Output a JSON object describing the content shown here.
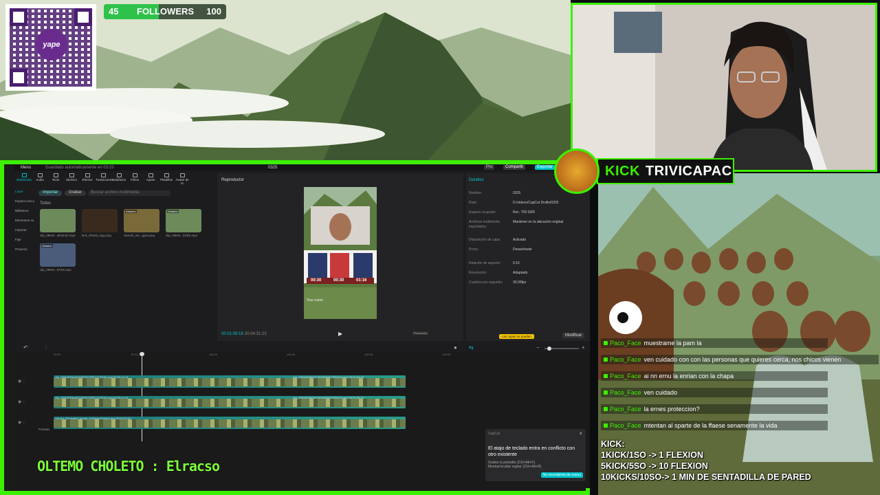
{
  "overlay": {
    "qr_brand": "yape",
    "followers": {
      "current": "45",
      "label": "FOLLOWERS",
      "goal": "100",
      "progress_fraction": 0.45
    },
    "kick_label": {
      "prefix": "KICK",
      "channel": "TRIVICAPAC"
    },
    "ticker_text": "OLTEMO CHOLETO : Elracso",
    "kick_rules": {
      "title": "KICK:",
      "lines": [
        "1KICK/1SO -> 1 FLEXION",
        "5KICK/5SO -> 10 FLEXION",
        "10KICKS/10SO-> 1 MIN DE SENTADILLA DE PARED"
      ]
    },
    "chat": [
      {
        "user": "Paco_Face",
        "message": "muestrame la pam la"
      },
      {
        "user": "Paco_Face",
        "message": "ven cuidado con con las personas que quieres cerca, nos chicos vienen"
      },
      {
        "user": "Paco_Face",
        "message": "ai nn ernu la enrian con la chapa"
      },
      {
        "user": "Paco_Face",
        "message": "ven cuidado"
      },
      {
        "user": "Paco_Face",
        "message": "la ernes proteccion?"
      },
      {
        "user": "Paco_Face",
        "message": "mtentan al sparte de la ffaese senamente la vida"
      }
    ],
    "colors": {
      "accent": "#3cf000",
      "followers_fill": "#2ec24a"
    }
  },
  "capcut": {
    "menu": "Menú",
    "autosave": "Guardado automáticamente en 03:23",
    "project_title": "0325",
    "top_right": {
      "pro": "Pro",
      "share": "Compartir",
      "export": "Exportar"
    },
    "toolbar": [
      "Multimedia",
      "Audio",
      "Texto",
      "Stickers",
      "Efectos",
      "Transiciones",
      "Subtítulos",
      "Filtros",
      "Ajuste",
      "Plantillas",
      "Avatar de IA"
    ],
    "sidebar": [
      "Local",
      "Espacio secundario",
      "Biblioteca",
      "Elementos multimedia",
      "Importar",
      "Fijar",
      "Proyecto"
    ],
    "media": {
      "import_label": "Importar",
      "record_label": "Grabar",
      "search_placeholder": "Buscar archivo multimedia",
      "filter_label": "Todos",
      "items": [
        {
          "name": "clip_09KM...4kN2AD.mp4",
          "badge": ""
        },
        {
          "name": "kick_Rh4Nt_logo.png",
          "badge": ""
        },
        {
          "name": "Gemini_Ge...gqv4.png",
          "badge": "Añadido"
        },
        {
          "name": "clip_09KM...2GbS.mp4",
          "badge": "Añadido"
        },
        {
          "name": "clip_09KM...9TZS.mp4",
          "badge": "Añadido"
        }
      ]
    },
    "player": {
      "title": "Reproductor",
      "current_time": "00:01:09:18",
      "total_time": "00:04:31:23",
      "ratio_label": "Proporción",
      "preview_numbers": [
        "00:30",
        "00:30",
        "01:16"
      ],
      "preview_caption": "Your name"
    },
    "details": {
      "title": "Detalles",
      "rows": [
        {
          "k": "Nombre:",
          "v": "0325"
        },
        {
          "k": "Ruta:",
          "v": "D:/videos/CapCut Drafts/0325"
        },
        {
          "k": "Espacio ocupado:",
          "v": "Rec. 709 SDR"
        },
        {
          "k": "Archivos multimedia importados:",
          "v": "Mantener en la ubicación original"
        },
        {
          "k": "Disposición de capa:",
          "v": "Activado"
        },
        {
          "k": "Proxy:",
          "v": "Desactivado"
        },
        {
          "k": "Relación de aspecto:",
          "v": "9:16"
        },
        {
          "k": "Resolución:",
          "v": "Adaptado"
        },
        {
          "k": "Cuadros por segundo:",
          "v": "30.00fps"
        }
      ],
      "modify_button": "Modificar",
      "tip_badge": "Las capas se pueden"
    },
    "timeline": {
      "ruler": [
        "00:00",
        "00:10",
        "100:20",
        "100:30",
        "100:40",
        "100:50"
      ],
      "tracks": [
        {
          "left_label": "clip_09KMHF6A4N79SRNT3F6FLFCRHG.mp4  00:03:12:13",
          "right_label": "clip_09KMHDNKM7SKN9SMACSR49J4.mp4  00:01:02:13"
        },
        {
          "left_label": "clip_09KMHF6A4N79SRNT3F6FLFCRHG.mp4  00:03:12:13",
          "right_label": "clip_09KMHDNKM7SKN9SMACSR49J4.mp4  00:01:02:13"
        },
        {
          "left_label": "Gemini_Generated_Image_ex3hwpvxrhwpvx.png  00:04:31:23",
          "right_label": ""
        }
      ],
      "cover_label": "Portada"
    },
    "notification": {
      "app": "CapCut",
      "title": "El atajo de teclado entra en conflicto con otro existente",
      "line1": "Grabar la pantalla: [Ctrl+Alt+F]",
      "line2": "Mostrar/ocultar reglas: [Ctrl+Alt+R]",
      "button": "No recordarme de nuevo"
    }
  }
}
